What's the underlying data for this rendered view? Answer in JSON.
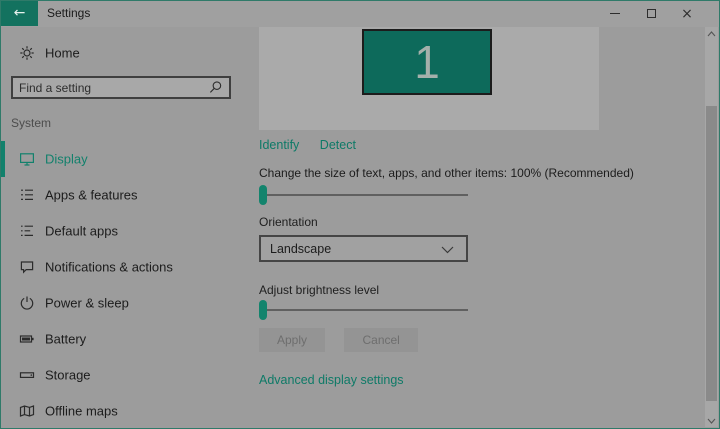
{
  "titlebar": {
    "title": "Settings",
    "back_glyph": "←",
    "close_glyph": "×"
  },
  "sidebar": {
    "home_label": "Home",
    "search_placeholder": "Find a setting",
    "section_label": "System",
    "items": [
      {
        "label": "Display",
        "icon": "display-icon",
        "selected": true
      },
      {
        "label": "Apps & features",
        "icon": "apps-features-icon",
        "selected": false
      },
      {
        "label": "Default apps",
        "icon": "default-apps-icon",
        "selected": false
      },
      {
        "label": "Notifications & actions",
        "icon": "notifications-icon",
        "selected": false
      },
      {
        "label": "Power & sleep",
        "icon": "power-icon",
        "selected": false
      },
      {
        "label": "Battery",
        "icon": "battery-icon",
        "selected": false
      },
      {
        "label": "Storage",
        "icon": "storage-icon",
        "selected": false
      },
      {
        "label": "Offline maps",
        "icon": "offline-maps-icon",
        "selected": false
      }
    ]
  },
  "main": {
    "preview": {
      "monitor_label": "1",
      "identify_link": "Identify",
      "detect_link": "Detect"
    },
    "scale_label": "Change the size of text, apps, and other items: 100% (Recommended)",
    "orientation_label": "Orientation",
    "orientation_value": "Landscape",
    "brightness_label": "Adjust brightness level",
    "apply_button": "Apply",
    "cancel_button": "Cancel",
    "advanced_link": "Advanced display settings"
  },
  "colors": {
    "accent_teal": "#13725f",
    "selected_item_teal": "#12816c",
    "link_teal": "#0e7a67",
    "monitor_fill": "#0d6a5b",
    "window_border": "#2f7a69",
    "background": "#9c9c9c",
    "preview_background": "#aaaaaa",
    "disabled_button_bg": "#949494",
    "disabled_button_text": "#6e6e6e"
  }
}
